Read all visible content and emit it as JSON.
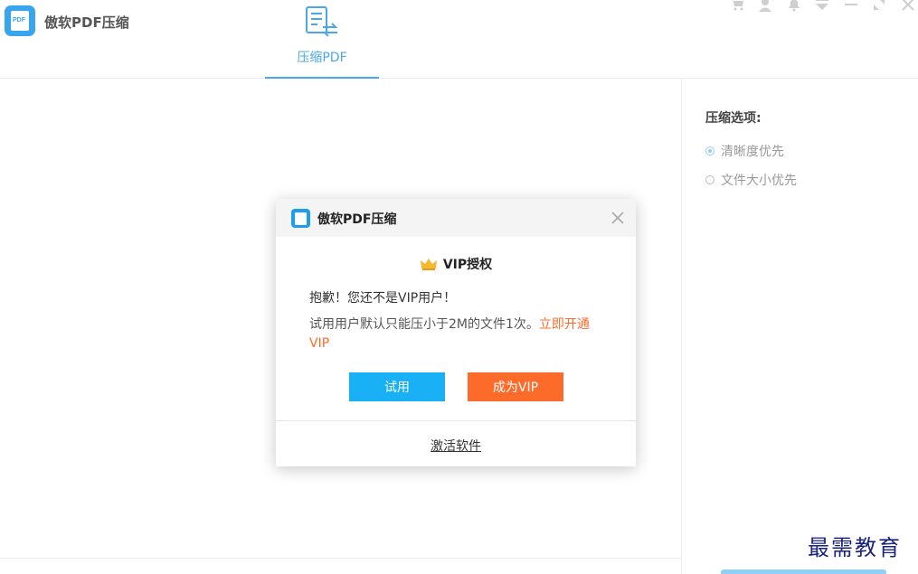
{
  "app": {
    "title": "傲软PDF压缩",
    "logo_text": "PDF"
  },
  "tabs": [
    {
      "label": "压缩PDF",
      "active": true,
      "icon": "compress-pdf-icon"
    }
  ],
  "window_controls": [
    "cart-icon",
    "user-icon",
    "bell-icon",
    "dropdown-icon",
    "minimize-icon",
    "maximize-icon",
    "close-icon"
  ],
  "side_panel": {
    "title": "压缩选项:",
    "options": [
      {
        "label": "清晰度优先",
        "selected": true
      },
      {
        "label": "文件大小优先",
        "selected": false
      }
    ]
  },
  "dialog": {
    "title": "傲软PDF压缩",
    "heading": "VIP授权",
    "message_1": "抱歉！您还不是VIP用户！",
    "message_2": "试用用户默认只能压小于2M的文件1次。",
    "message_2_link": "立即开通VIP",
    "trial_button": "试用",
    "vip_button": "成为VIP",
    "activate_link": "激活软件"
  },
  "watermark": "最需教育",
  "colors": {
    "accent": "#4aa8e8",
    "primary_button": "#1ab0f6",
    "vip_button": "#fd6b2b",
    "link": "#fd6b2b"
  }
}
